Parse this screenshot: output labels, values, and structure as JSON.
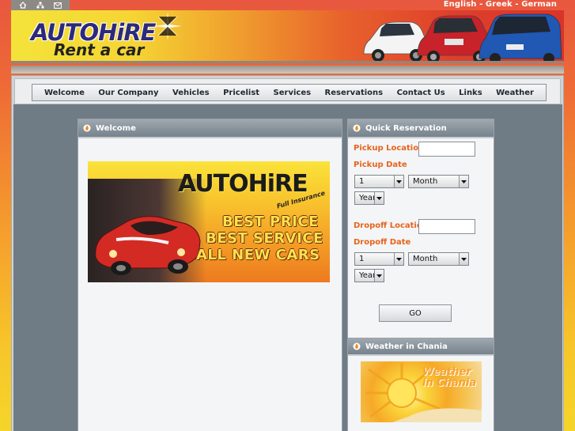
{
  "top_icons": [
    {
      "name": "home-icon"
    },
    {
      "name": "sitemap-icon"
    },
    {
      "name": "mail-icon"
    }
  ],
  "languages": {
    "english": "English",
    "greek": "Greek",
    "german": "German",
    "separator": " - "
  },
  "header": {
    "logo_line1": "AUTOHiRE",
    "logo_line2": "Rent a car"
  },
  "nav": {
    "items": [
      "Welcome",
      "Our Company",
      "Vehicles",
      "Pricelist",
      "Services",
      "Reservations",
      "Contact Us",
      "Links",
      "Weather"
    ]
  },
  "welcome_panel": {
    "title": "Welcome",
    "banner": {
      "brand": "AUTOHiRE",
      "tagline": "Full Insurance",
      "lines": [
        "BEST PRICE",
        "BEST SERVICE",
        "ALL NEW CARS"
      ]
    }
  },
  "reservation": {
    "title": "Quick Reservation",
    "pickup_location_label": "Pickup Location",
    "pickup_location_value": "",
    "pickup_date_label": "Pickup Date",
    "pickup_day": "1",
    "pickup_month": "Month",
    "pickup_year": "Year",
    "dropoff_location_label": "Dropoff Location",
    "dropoff_location_value": "",
    "dropoff_date_label": "Dropoff Date",
    "dropoff_day": "1",
    "dropoff_month": "Month",
    "dropoff_year": "Year",
    "go_label": "GO"
  },
  "weather_panel": {
    "title": "Weather in Chania",
    "image_text_line1": "Weather",
    "image_text_line2": "in Chania"
  },
  "colors": {
    "accent_orange": "#e8641a",
    "logo_blue": "#2d2a7c",
    "panel_header": "#76828c"
  }
}
